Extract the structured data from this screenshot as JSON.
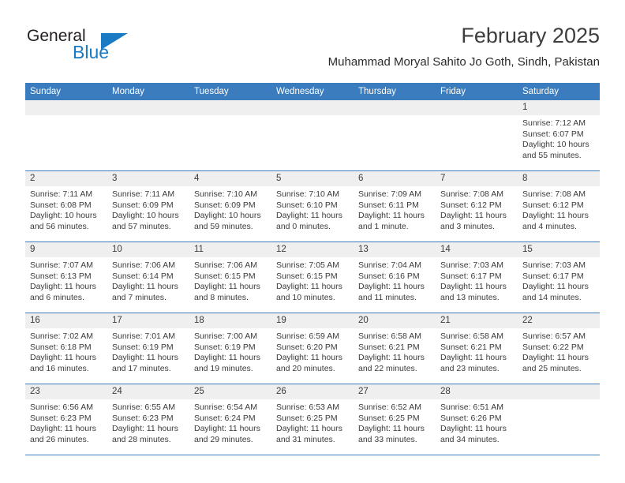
{
  "logo": {
    "word1": "General",
    "word2": "Blue",
    "triangle_color": "#1a7ac4",
    "word1_color": "#231f20",
    "word2_color": "#1a7ac4"
  },
  "header": {
    "title": "February 2025",
    "subtitle": "Muhammad Moryal Sahito Jo Goth, Sindh, Pakistan"
  },
  "theme": {
    "header_bg": "#3a7cbe",
    "header_text": "#ffffff",
    "daynum_band_bg": "#efefef",
    "row_border": "#3a7cbe",
    "cell_bg": "#ffffff",
    "text": "#3b3b3b"
  },
  "weekday_headers": [
    "Sunday",
    "Monday",
    "Tuesday",
    "Wednesday",
    "Thursday",
    "Friday",
    "Saturday"
  ],
  "weeks": [
    [
      {
        "day": "",
        "sunrise": "",
        "sunset": "",
        "daylight": ""
      },
      {
        "day": "",
        "sunrise": "",
        "sunset": "",
        "daylight": ""
      },
      {
        "day": "",
        "sunrise": "",
        "sunset": "",
        "daylight": ""
      },
      {
        "day": "",
        "sunrise": "",
        "sunset": "",
        "daylight": ""
      },
      {
        "day": "",
        "sunrise": "",
        "sunset": "",
        "daylight": ""
      },
      {
        "day": "",
        "sunrise": "",
        "sunset": "",
        "daylight": ""
      },
      {
        "day": "1",
        "sunrise": "Sunrise: 7:12 AM",
        "sunset": "Sunset: 6:07 PM",
        "daylight": "Daylight: 10 hours and 55 minutes."
      }
    ],
    [
      {
        "day": "2",
        "sunrise": "Sunrise: 7:11 AM",
        "sunset": "Sunset: 6:08 PM",
        "daylight": "Daylight: 10 hours and 56 minutes."
      },
      {
        "day": "3",
        "sunrise": "Sunrise: 7:11 AM",
        "sunset": "Sunset: 6:09 PM",
        "daylight": "Daylight: 10 hours and 57 minutes."
      },
      {
        "day": "4",
        "sunrise": "Sunrise: 7:10 AM",
        "sunset": "Sunset: 6:09 PM",
        "daylight": "Daylight: 10 hours and 59 minutes."
      },
      {
        "day": "5",
        "sunrise": "Sunrise: 7:10 AM",
        "sunset": "Sunset: 6:10 PM",
        "daylight": "Daylight: 11 hours and 0 minutes."
      },
      {
        "day": "6",
        "sunrise": "Sunrise: 7:09 AM",
        "sunset": "Sunset: 6:11 PM",
        "daylight": "Daylight: 11 hours and 1 minute."
      },
      {
        "day": "7",
        "sunrise": "Sunrise: 7:08 AM",
        "sunset": "Sunset: 6:12 PM",
        "daylight": "Daylight: 11 hours and 3 minutes."
      },
      {
        "day": "8",
        "sunrise": "Sunrise: 7:08 AM",
        "sunset": "Sunset: 6:12 PM",
        "daylight": "Daylight: 11 hours and 4 minutes."
      }
    ],
    [
      {
        "day": "9",
        "sunrise": "Sunrise: 7:07 AM",
        "sunset": "Sunset: 6:13 PM",
        "daylight": "Daylight: 11 hours and 6 minutes."
      },
      {
        "day": "10",
        "sunrise": "Sunrise: 7:06 AM",
        "sunset": "Sunset: 6:14 PM",
        "daylight": "Daylight: 11 hours and 7 minutes."
      },
      {
        "day": "11",
        "sunrise": "Sunrise: 7:06 AM",
        "sunset": "Sunset: 6:15 PM",
        "daylight": "Daylight: 11 hours and 8 minutes."
      },
      {
        "day": "12",
        "sunrise": "Sunrise: 7:05 AM",
        "sunset": "Sunset: 6:15 PM",
        "daylight": "Daylight: 11 hours and 10 minutes."
      },
      {
        "day": "13",
        "sunrise": "Sunrise: 7:04 AM",
        "sunset": "Sunset: 6:16 PM",
        "daylight": "Daylight: 11 hours and 11 minutes."
      },
      {
        "day": "14",
        "sunrise": "Sunrise: 7:03 AM",
        "sunset": "Sunset: 6:17 PM",
        "daylight": "Daylight: 11 hours and 13 minutes."
      },
      {
        "day": "15",
        "sunrise": "Sunrise: 7:03 AM",
        "sunset": "Sunset: 6:17 PM",
        "daylight": "Daylight: 11 hours and 14 minutes."
      }
    ],
    [
      {
        "day": "16",
        "sunrise": "Sunrise: 7:02 AM",
        "sunset": "Sunset: 6:18 PM",
        "daylight": "Daylight: 11 hours and 16 minutes."
      },
      {
        "day": "17",
        "sunrise": "Sunrise: 7:01 AM",
        "sunset": "Sunset: 6:19 PM",
        "daylight": "Daylight: 11 hours and 17 minutes."
      },
      {
        "day": "18",
        "sunrise": "Sunrise: 7:00 AM",
        "sunset": "Sunset: 6:19 PM",
        "daylight": "Daylight: 11 hours and 19 minutes."
      },
      {
        "day": "19",
        "sunrise": "Sunrise: 6:59 AM",
        "sunset": "Sunset: 6:20 PM",
        "daylight": "Daylight: 11 hours and 20 minutes."
      },
      {
        "day": "20",
        "sunrise": "Sunrise: 6:58 AM",
        "sunset": "Sunset: 6:21 PM",
        "daylight": "Daylight: 11 hours and 22 minutes."
      },
      {
        "day": "21",
        "sunrise": "Sunrise: 6:58 AM",
        "sunset": "Sunset: 6:21 PM",
        "daylight": "Daylight: 11 hours and 23 minutes."
      },
      {
        "day": "22",
        "sunrise": "Sunrise: 6:57 AM",
        "sunset": "Sunset: 6:22 PM",
        "daylight": "Daylight: 11 hours and 25 minutes."
      }
    ],
    [
      {
        "day": "23",
        "sunrise": "Sunrise: 6:56 AM",
        "sunset": "Sunset: 6:23 PM",
        "daylight": "Daylight: 11 hours and 26 minutes."
      },
      {
        "day": "24",
        "sunrise": "Sunrise: 6:55 AM",
        "sunset": "Sunset: 6:23 PM",
        "daylight": "Daylight: 11 hours and 28 minutes."
      },
      {
        "day": "25",
        "sunrise": "Sunrise: 6:54 AM",
        "sunset": "Sunset: 6:24 PM",
        "daylight": "Daylight: 11 hours and 29 minutes."
      },
      {
        "day": "26",
        "sunrise": "Sunrise: 6:53 AM",
        "sunset": "Sunset: 6:25 PM",
        "daylight": "Daylight: 11 hours and 31 minutes."
      },
      {
        "day": "27",
        "sunrise": "Sunrise: 6:52 AM",
        "sunset": "Sunset: 6:25 PM",
        "daylight": "Daylight: 11 hours and 33 minutes."
      },
      {
        "day": "28",
        "sunrise": "Sunrise: 6:51 AM",
        "sunset": "Sunset: 6:26 PM",
        "daylight": "Daylight: 11 hours and 34 minutes."
      },
      {
        "day": "",
        "sunrise": "",
        "sunset": "",
        "daylight": ""
      }
    ]
  ]
}
